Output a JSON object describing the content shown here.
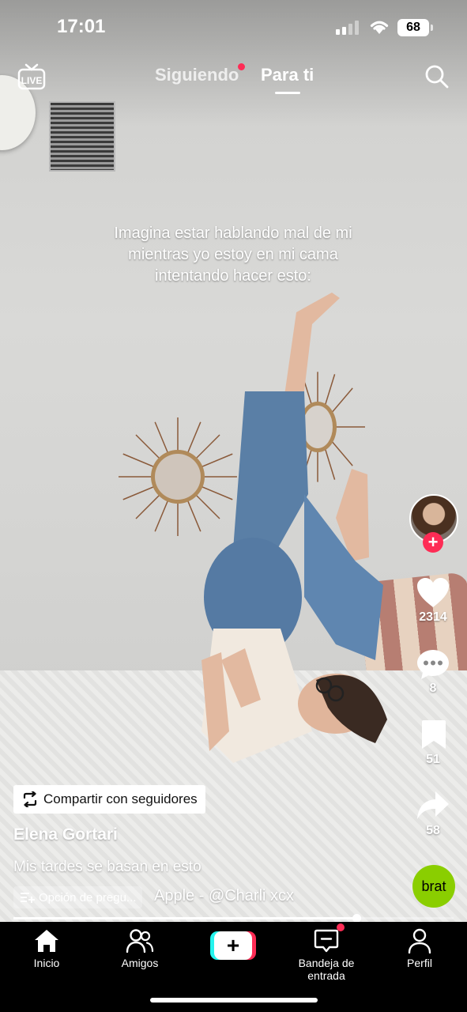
{
  "status_bar": {
    "time": "17:01",
    "battery": "68"
  },
  "top_nav": {
    "live_icon": "live-tv-icon",
    "tabs": [
      {
        "label": "Siguiendo",
        "has_dot": true
      },
      {
        "label": "Para ti",
        "active": true
      }
    ],
    "search_icon": "search-icon"
  },
  "video": {
    "overlay_text": "Imagina estar hablando mal de mi mientras yo estoy en mi cama intentando hacer esto:"
  },
  "right_rail": {
    "likes": "2314",
    "comments": "8",
    "saves": "51",
    "shares": "58",
    "sound_disc_label": "brat"
  },
  "info": {
    "share_button": "Compartir con seguidores",
    "author": "Elena Gortari",
    "caption": "Mis tardes se basan en esto",
    "qa_chip": "Opción de pregu...",
    "sound": "Apple - @Charli xcx"
  },
  "progress": {
    "fraction": 0.78
  },
  "tab_bar": {
    "items": [
      {
        "label": "Inicio",
        "icon": "home-icon",
        "active": true
      },
      {
        "label": "Amigos",
        "icon": "friends-icon"
      },
      {
        "label": "",
        "icon": "create-plus-icon"
      },
      {
        "label": "Bandeja de entrada",
        "icon": "inbox-icon",
        "has_dot": true
      },
      {
        "label": "Perfil",
        "icon": "profile-icon"
      }
    ]
  },
  "colors": {
    "accent": "#fe2c55",
    "cyan": "#25f4ee",
    "brat_green": "#8ace00"
  }
}
